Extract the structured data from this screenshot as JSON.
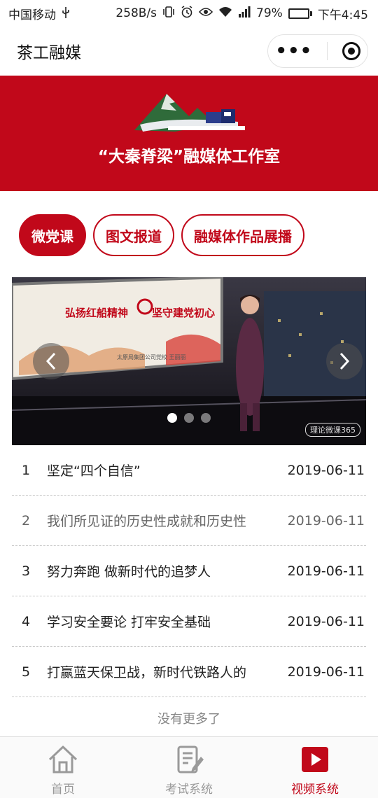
{
  "status_bar": {
    "carrier": "中国移动",
    "usb_icon": "usb-icon",
    "speed": "258B/s",
    "battery_percent": "79%",
    "battery_level": 0.79,
    "time": "下午4:45"
  },
  "navbar": {
    "title": "茶工融媒",
    "more_icon": "•••",
    "close_icon": "target-icon"
  },
  "banner": {
    "title": "“大秦脊梁”融媒体工作室",
    "brand_color": "#c1081a"
  },
  "tabs": [
    {
      "label": "微党课",
      "active": true
    },
    {
      "label": "图文报道",
      "active": false
    },
    {
      "label": "融媒体作品展播",
      "active": false
    }
  ],
  "carousel": {
    "screen_text_left": "弘扬红船精神",
    "screen_text_right": "坚守建党初心",
    "screen_caption": "太原局集团公司党校    王丽丽",
    "watermark": "理论微课365",
    "dot_count": 3,
    "active_dot": 0
  },
  "list": [
    {
      "num": "1",
      "title": "坚定“四个自信”",
      "date": "2019-06-11",
      "muted": false
    },
    {
      "num": "2",
      "title": "我们所见证的历史性成就和历史性",
      "date": "2019-06-11",
      "muted": true
    },
    {
      "num": "3",
      "title": "努力奔跑 做新时代的追梦人",
      "date": "2019-06-11",
      "muted": false
    },
    {
      "num": "4",
      "title": "学习安全要论 打牢安全基础",
      "date": "2019-06-11",
      "muted": false
    },
    {
      "num": "5",
      "title": "打赢蓝天保卫战，新时代铁路人的",
      "date": "2019-06-11",
      "muted": false
    }
  ],
  "no_more": "没有更多了",
  "tabbar": [
    {
      "label": "首页",
      "icon": "home-icon",
      "active": false
    },
    {
      "label": "考试系统",
      "icon": "exam-edit-icon",
      "active": false
    },
    {
      "label": "视频系统",
      "icon": "video-play-icon",
      "active": true
    }
  ]
}
